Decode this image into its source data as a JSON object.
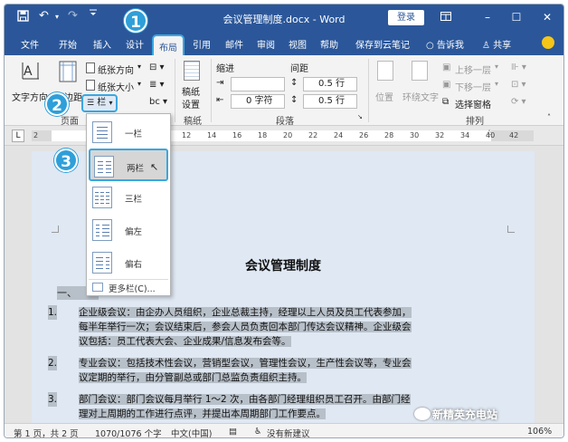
{
  "titlebar": {
    "save_icon": "save-icon",
    "undo_icon": "undo-icon",
    "redo_icon": "redo-icon",
    "qa_more": "≡",
    "title": "会议管理制度.docx - Word",
    "login": "登录",
    "ribbon_display_icon": "ribbon-display-icon",
    "minimize": "–",
    "restore": "☐",
    "close": "✕"
  },
  "tabs": [
    "文件",
    "开始",
    "插入",
    "设计",
    "布局",
    "引用",
    "邮件",
    "审阅",
    "视图",
    "帮助",
    "保存到云笔记",
    "告诉我",
    "共享"
  ],
  "ribbon": {
    "text_direction": "文字方向",
    "margins": "页边距",
    "orientation": "纸张方向",
    "size": "纸张大小",
    "columns": "栏",
    "page_setup_group": "页面",
    "manuscript": "稿纸",
    "manuscript_setting": "设置",
    "manuscript_group": "稿纸",
    "indent_label": "缩进",
    "spacing_label": "间距",
    "indent_left": "",
    "indent_right": "0 字符",
    "spacing_before": "0.5 行",
    "spacing_after": "0.5 行",
    "paragraph_group": "段落",
    "position": "位置",
    "wrap_text": "环绕文字",
    "bring_forward": "上移一层",
    "send_backward": "下移一层",
    "selection_pane": "选择窗格",
    "arrange_group": "排列"
  },
  "ruler": {
    "tab_marker": "L",
    "numbers": [
      "2",
      "12",
      "14",
      "16",
      "18",
      "20",
      "22",
      "24",
      "26",
      "28",
      "30",
      "32",
      "34",
      "36",
      "38",
      "40",
      "42",
      "44"
    ]
  },
  "columns_menu": {
    "items": [
      "一栏",
      "两栏",
      "三栏",
      "偏左",
      "偏右"
    ],
    "more": "更多栏(C)..."
  },
  "document": {
    "title": "会议管理制度",
    "heading": "一、",
    "paragraphs": [
      {
        "num": "1.",
        "lines": [
          "企业级会议：由企办人员组织，企业总裁主持，经理以上人员及员工代表参加，",
          "每半年举行一次；会议结束后，参会人员负责回本部门传达会议精神。企业级会",
          "议包括：员工代表大会、企业成果/信息发布会等。"
        ]
      },
      {
        "num": "2.",
        "lines": [
          "专业会议：包括技术性会议，营销型会议，管理性会议，生产性会议等，专业会",
          "议定期的举行，由分管副总或部门总监负责组织主持。"
        ]
      },
      {
        "num": "3.",
        "lines": [
          "部门会议：部门会议每月举行 1～2 次，由各部门经理组织员工召开。由部门经",
          "理对上周期的工作进行点评，并提出本周期部门工作要点。"
        ]
      }
    ]
  },
  "statusbar": {
    "page": "第 1 页，共 2 页",
    "words": "1070/1076 个字",
    "language": "中文(中国)",
    "accessibility": "没有新建议",
    "zoom": "106%"
  },
  "callouts": [
    "1",
    "2",
    "3"
  ],
  "watermark": "新精英充电站",
  "colors": {
    "accent": "#2b579a",
    "callout": "#2f9fd9",
    "highlight_border": "#3aa7e0"
  }
}
